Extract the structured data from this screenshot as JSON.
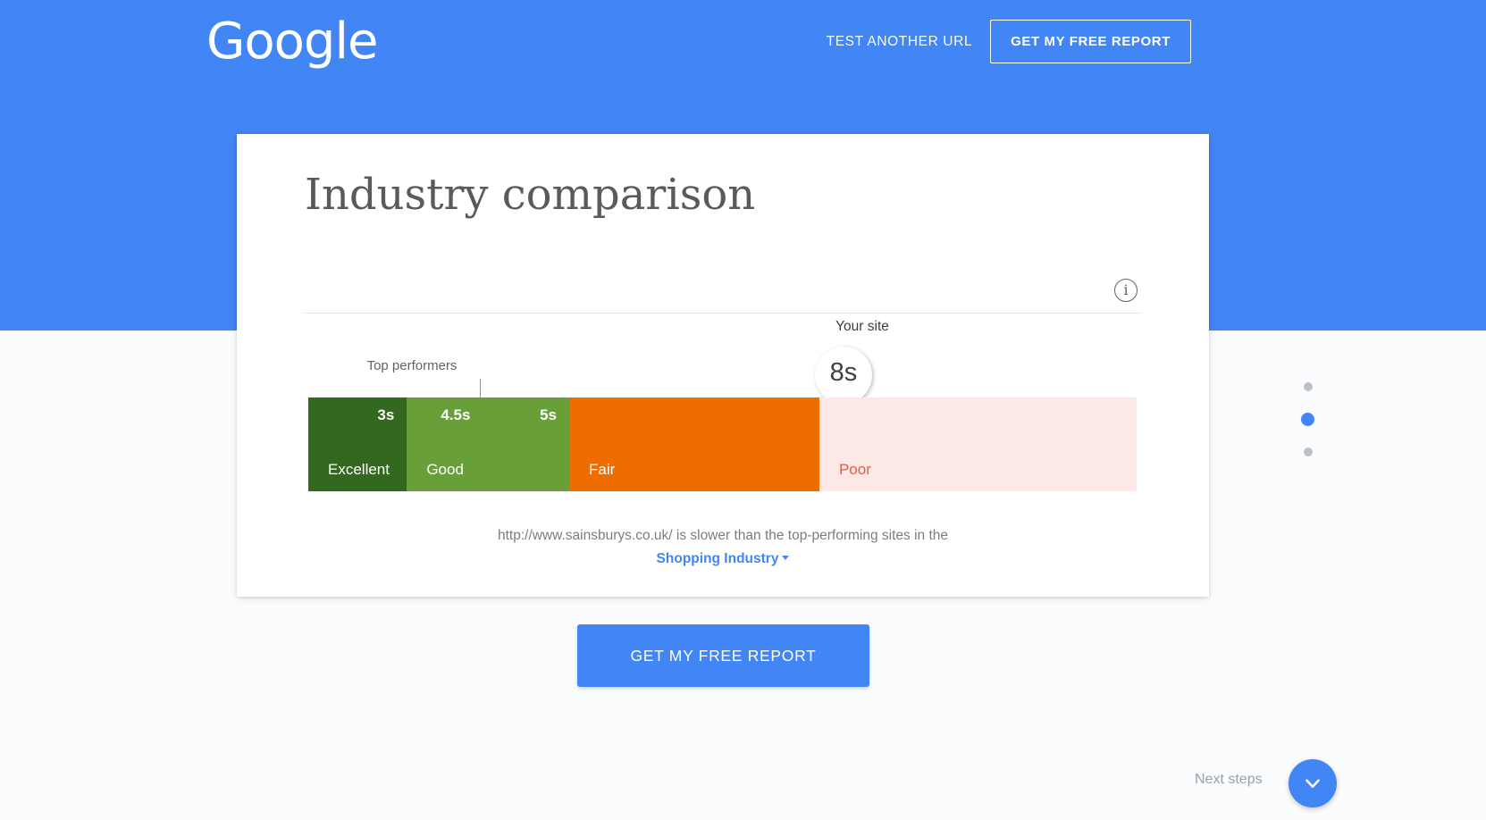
{
  "header": {
    "logo_text": "Google",
    "test_another_url_label": "TEST ANOTHER URL",
    "free_report_label": "GET MY FREE REPORT",
    "background_color": "#4285f4"
  },
  "card": {
    "title": "Industry comparison",
    "info_icon_glyph": "i"
  },
  "chart_data": {
    "type": "bar",
    "title": "Industry comparison",
    "orientation": "horizontal-stacked",
    "xlabel": "",
    "ylabel": "",
    "unit": "seconds",
    "axis_range": [
      0,
      14
    ],
    "grid": false,
    "legend_position": "inline",
    "categories": [
      "Excellent",
      "Good",
      "Fair",
      "Poor"
    ],
    "segments": [
      {
        "label": "Excellent",
        "boundary_time": "3s",
        "start": 0,
        "end": 3,
        "width_pct": 11.9,
        "color": "#33691e",
        "text_color": "#ffffff"
      },
      {
        "label": "Good",
        "boundary_time": "4.5s",
        "start": 3,
        "end": 5,
        "width_pct": 19.6,
        "color": "#689f38",
        "text_color": "#ffffff",
        "extra_time": "5s"
      },
      {
        "label": "Fair",
        "boundary_time": "",
        "start": 5,
        "end": 8,
        "width_pct": 30.2,
        "color": "#ef6c00",
        "text_color": "#ffffff"
      },
      {
        "label": "Poor",
        "boundary_time": "",
        "start": 8,
        "end": 14,
        "width_pct": 38.3,
        "color": "#fce9e6",
        "text_color": "#e25c4a"
      }
    ],
    "annotations": [
      {
        "name": "top-performers",
        "label": "Top performers",
        "at_time": "4.5s"
      },
      {
        "name": "your-site",
        "label": "Your site",
        "value": "8s",
        "at_time": "8s"
      }
    ]
  },
  "caption": {
    "url": "http://www.sainsburys.co.uk/",
    "text": " is slower than the top-performing sites in the",
    "industry_link": "Shopping Industry"
  },
  "cta": {
    "label": "GET MY FREE REPORT"
  },
  "pagination": {
    "dots": [
      {
        "active": false
      },
      {
        "active": true
      },
      {
        "active": false
      }
    ]
  },
  "footer": {
    "next_steps_label": "Next steps",
    "scroll_icon": "chevron-down-icon"
  }
}
